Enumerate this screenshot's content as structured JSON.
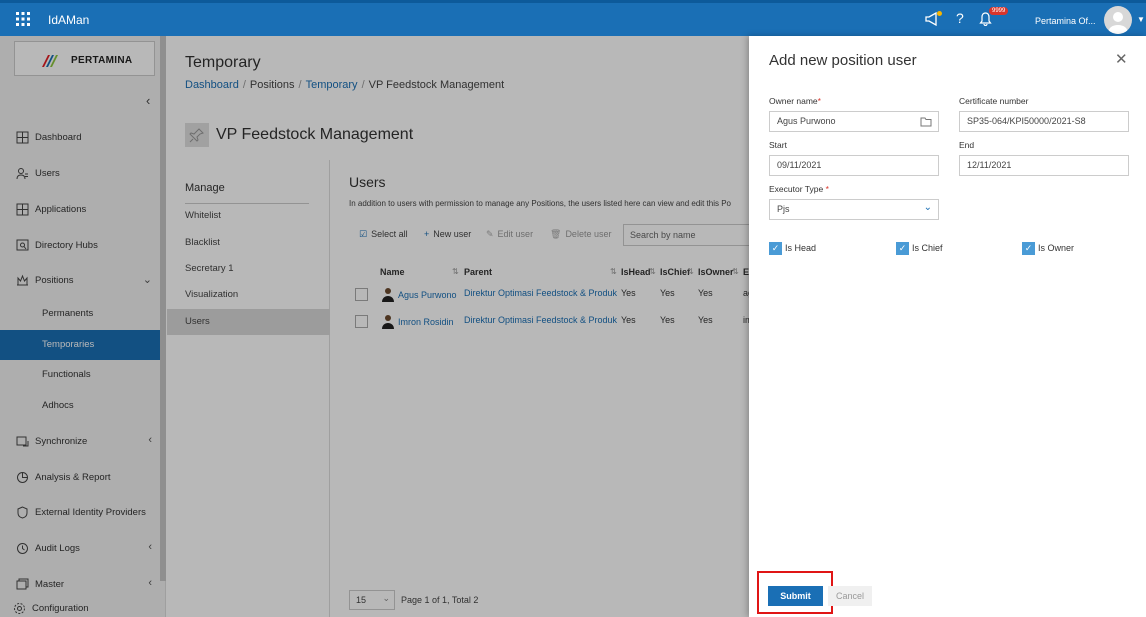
{
  "app": {
    "title": "IdAMan",
    "user_name": "Pertamina Of...",
    "notification_count": "9999"
  },
  "logo": {
    "text": "PERTAMINA"
  },
  "sidebar": {
    "items": [
      {
        "label": "Dashboard",
        "icon": "dashboard-icon"
      },
      {
        "label": "Users",
        "icon": "users-icon"
      },
      {
        "label": "Applications",
        "icon": "applications-icon"
      },
      {
        "label": "Directory Hubs",
        "icon": "directory-hubs-icon"
      },
      {
        "label": "Positions",
        "icon": "positions-icon"
      },
      {
        "label": "Synchronize",
        "icon": "synchronize-icon"
      },
      {
        "label": "Analysis & Report",
        "icon": "analysis-icon"
      },
      {
        "label": "External Identity Providers",
        "icon": "shield-icon"
      },
      {
        "label": "Audit Logs",
        "icon": "audit-logs-icon"
      },
      {
        "label": "Master",
        "icon": "master-icon"
      },
      {
        "label": "Configuration",
        "icon": "gear-icon"
      }
    ],
    "sub_items": [
      "Permanents",
      "Temporaries",
      "Functionals",
      "Adhocs"
    ]
  },
  "page": {
    "title": "Temporary",
    "breadcrumb": [
      "Dashboard",
      "Positions",
      "Temporary",
      "VP Feedstock Management"
    ],
    "position_title": "VP Feedstock Management"
  },
  "manage": {
    "title": "Manage",
    "items": [
      "Whitelist",
      "Blacklist",
      "Secretary 1",
      "Visualization",
      "Users"
    ]
  },
  "users": {
    "title": "Users",
    "description": "In addition to users with permission to manage any Positions, the users listed here can view and edit this Po",
    "toolbar": {
      "select_all": "Select all",
      "new_user": "New user",
      "edit_user": "Edit user",
      "delete_user": "Delete user",
      "search_placeholder": "Search by name"
    },
    "columns": [
      "Name",
      "Parent",
      "IsHead",
      "IsChief",
      "IsOwner",
      "E"
    ],
    "rows": [
      {
        "name": "Agus Purwono",
        "parent": "Direktur Optimasi Feedstock & Produk",
        "is_head": "Yes",
        "is_chief": "Yes",
        "is_owner": "Yes",
        "extra": "ag"
      },
      {
        "name": "Imron Rosidin",
        "parent": "Direktur Optimasi Feedstock & Produk",
        "is_head": "Yes",
        "is_chief": "Yes",
        "is_owner": "Yes",
        "extra": "im"
      }
    ],
    "pager": {
      "page_size": "15",
      "text": "Page 1 of 1, Total 2"
    }
  },
  "modal": {
    "title": "Add new position user",
    "owner_name": {
      "label": "Owner name",
      "value": "Agus Purwono"
    },
    "certificate_number": {
      "label": "Certificate number",
      "value": "SP35-064/KPI50000/2021-S8"
    },
    "start": {
      "label": "Start",
      "value": "09/11/2021"
    },
    "end": {
      "label": "End",
      "value": "12/11/2021"
    },
    "executor_type": {
      "label": "Executor Type",
      "value": "Pjs"
    },
    "checkboxes": {
      "is_head": "Is Head",
      "is_chief": "Is Chief",
      "is_owner": "Is Owner"
    },
    "submit_label": "Submit",
    "cancel_label": "Cancel"
  },
  "colors": {
    "primary": "#1a6fb5",
    "highlight": "#e01515",
    "badge": "#d9352b"
  }
}
